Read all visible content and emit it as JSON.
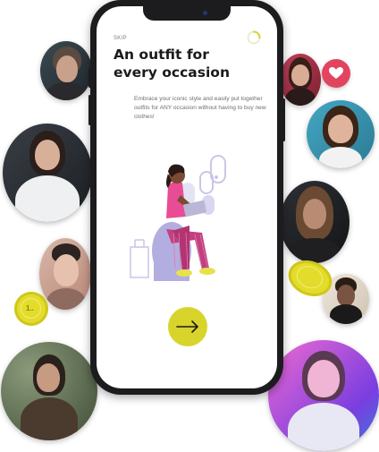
{
  "onboarding": {
    "skip_label": "SKIP",
    "title_line1": "An outfit for",
    "title_line2": "every occasion",
    "subtitle": "Embrace your iconic style and easily put together outfits for ANY occasion without having to buy new clothes!",
    "step_progress": 0.25,
    "next_icon": "arrow-right-icon"
  },
  "decor": {
    "coin_small_label": "1..",
    "heart_icon": "heart-icon"
  },
  "colors": {
    "accent": "#d8d42c",
    "heart": "#e2445f",
    "phone_frame": "#1c1c1e",
    "title": "#1a1a1a"
  }
}
